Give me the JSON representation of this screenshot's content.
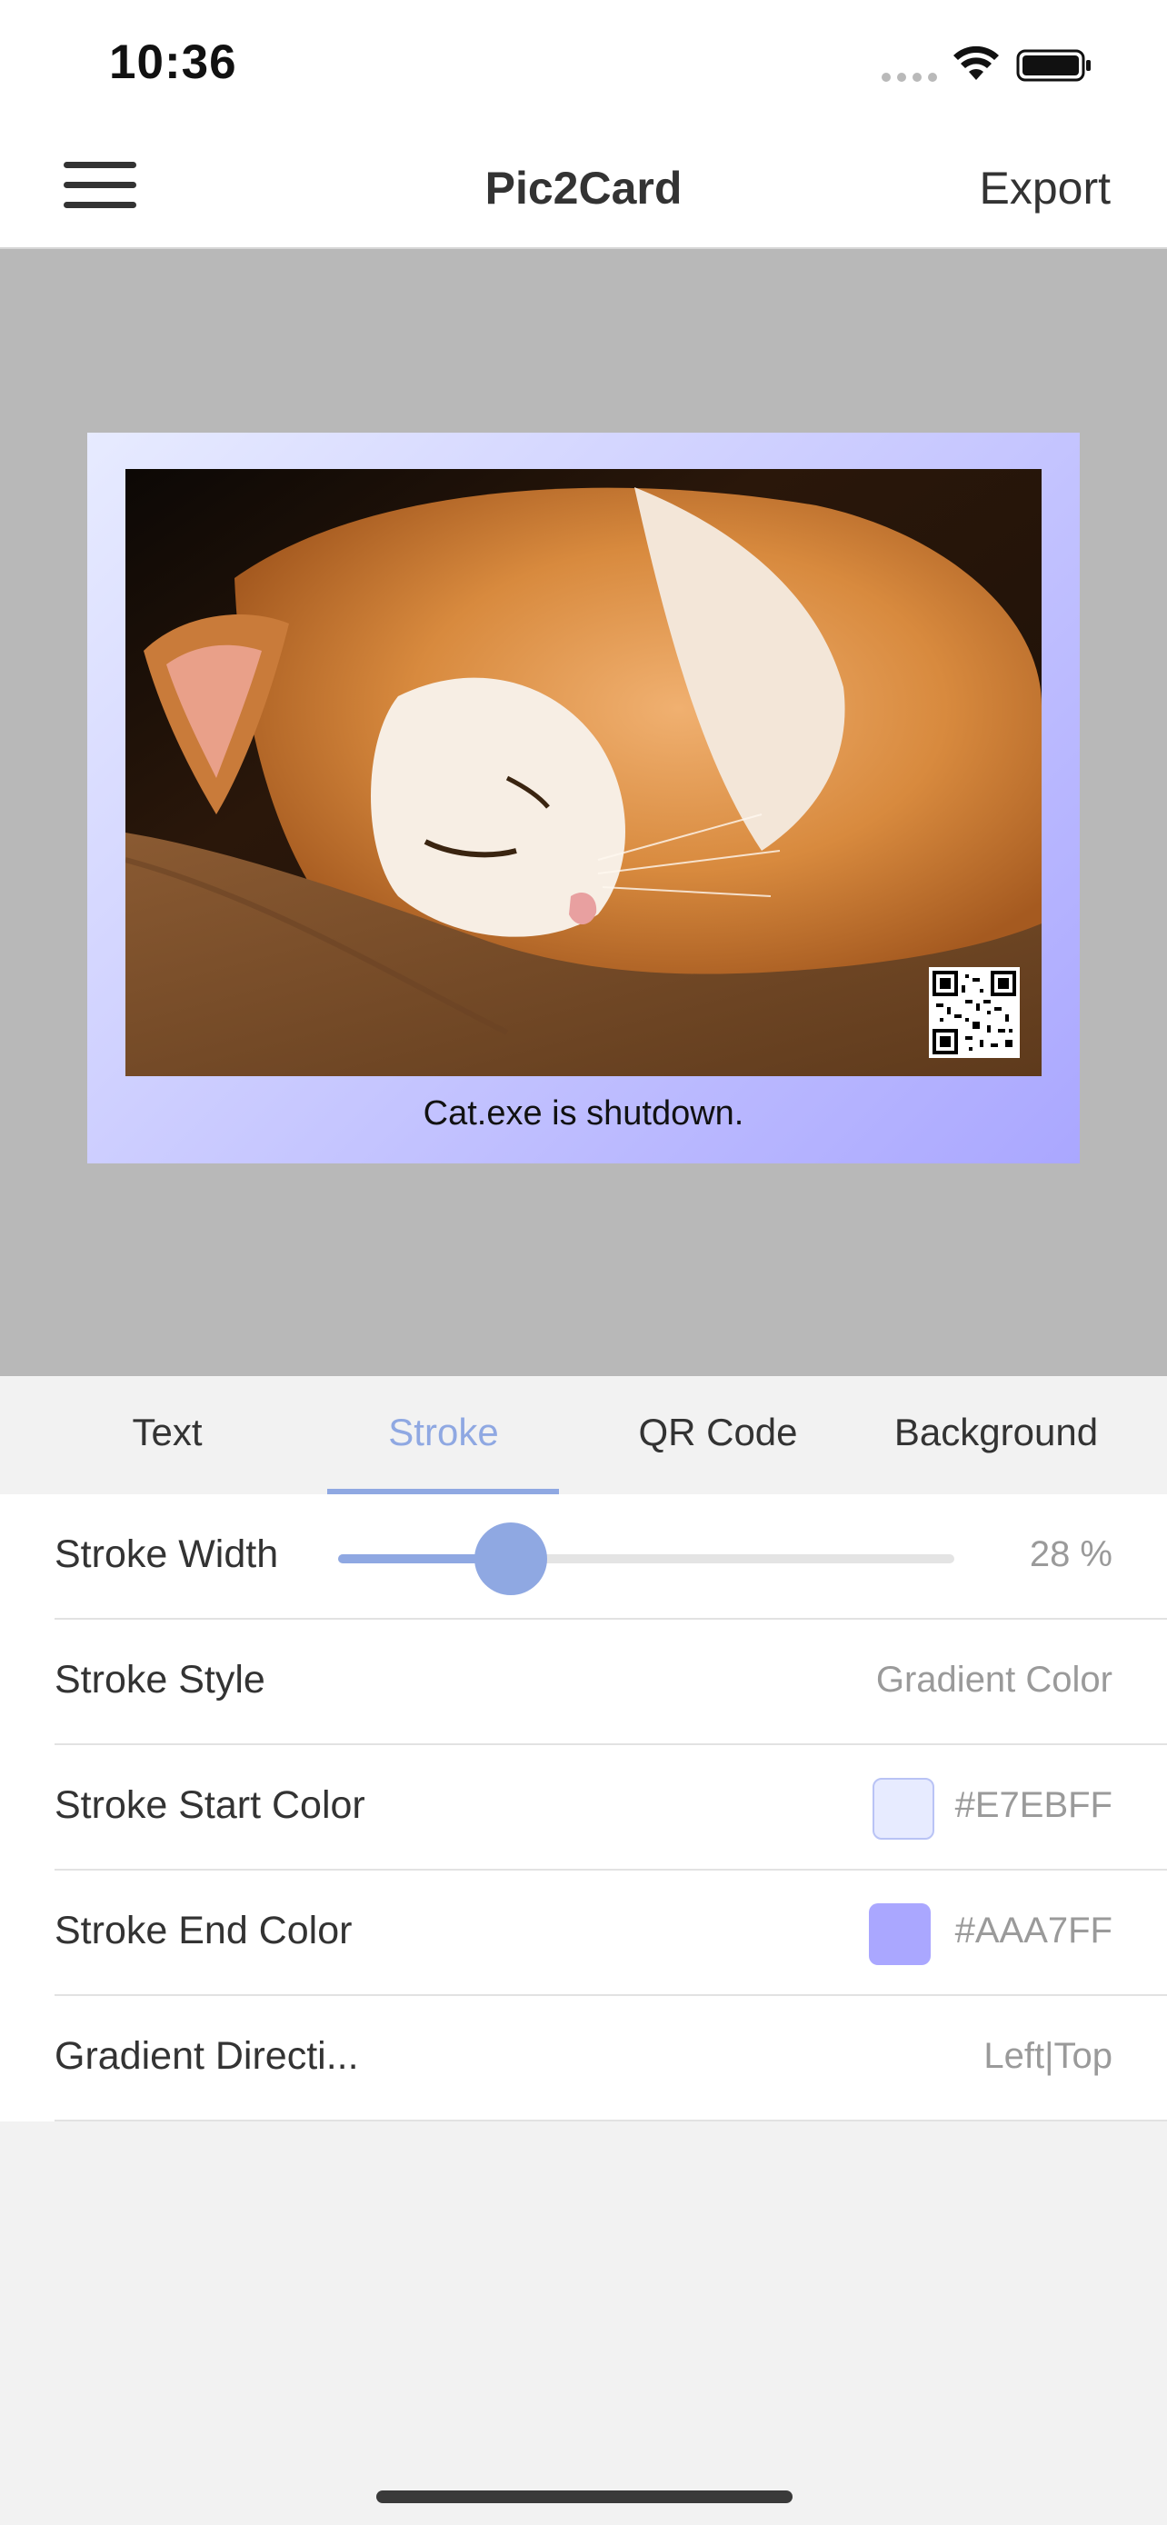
{
  "status_bar": {
    "time": "10:36"
  },
  "nav": {
    "title": "Pic2Card",
    "export_label": "Export",
    "menu_icon": "hamburger-menu-icon"
  },
  "card": {
    "caption": "Cat.exe is shutdown.",
    "photo_subject": "sleeping orange and white cat",
    "stroke_start_color": "#E7EBFF",
    "stroke_end_color": "#AAA7FF"
  },
  "tabs": [
    {
      "label": "Text",
      "active": false
    },
    {
      "label": "Stroke",
      "active": true
    },
    {
      "label": "QR Code",
      "active": false
    },
    {
      "label": "Background",
      "active": false
    }
  ],
  "settings": {
    "stroke_width": {
      "label": "Stroke Width",
      "value_text": "28 %",
      "value": 0.28
    },
    "stroke_style": {
      "label": "Stroke Style",
      "value": "Gradient Color"
    },
    "stroke_start_color": {
      "label": "Stroke Start Color",
      "value": "#E7EBFF"
    },
    "stroke_end_color": {
      "label": "Stroke End Color",
      "value": "#AAA7FF"
    },
    "gradient_direction": {
      "label": "Gradient Directi...",
      "value": "Left|Top"
    }
  },
  "colors": {
    "accent": "#8fa8e2",
    "canvas_background": "#b8b8b8"
  }
}
